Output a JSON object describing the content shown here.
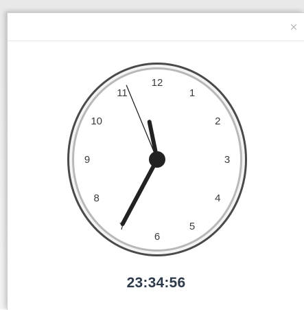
{
  "modal": {
    "close_label": "×",
    "close_icon": "close-icon"
  },
  "clock": {
    "numerals": [
      "12",
      "1",
      "2",
      "3",
      "4",
      "5",
      "6",
      "7",
      "8",
      "9",
      "10",
      "11"
    ],
    "time": {
      "hours": 23,
      "minutes": 34,
      "seconds": 56
    },
    "display_time": "23:34:56",
    "colors": {
      "hands": "#222222",
      "rim_outer": "#555555",
      "rim_inner": "#bdbdbd",
      "numerals": "#3b3b3b"
    }
  }
}
